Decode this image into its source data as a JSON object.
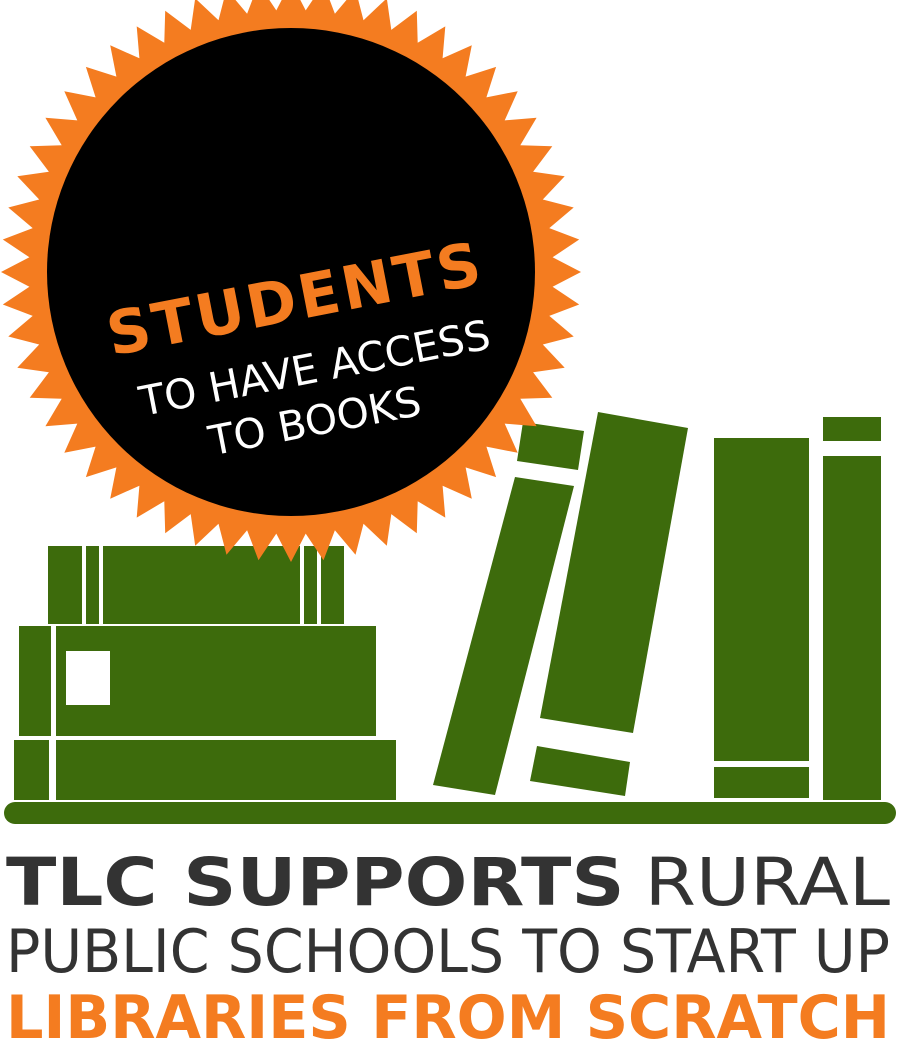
{
  "badge": {
    "headline": "STUDENTS",
    "line1": "TO HAVE ACCESS",
    "line2": "TO BOOKS"
  },
  "footer": {
    "line1_bold": "TLC SUPPORTS",
    "line1_light": "RURAL",
    "line2": "PUBLIC SCHOOLS TO START UP",
    "line3": "LIBRARIES FROM SCRATCH"
  },
  "colors": {
    "orange": "#f47c20",
    "green": "#3d6b0c",
    "badge_fill": "#000000",
    "dark_text": "#333333",
    "background": "#ffffff"
  }
}
